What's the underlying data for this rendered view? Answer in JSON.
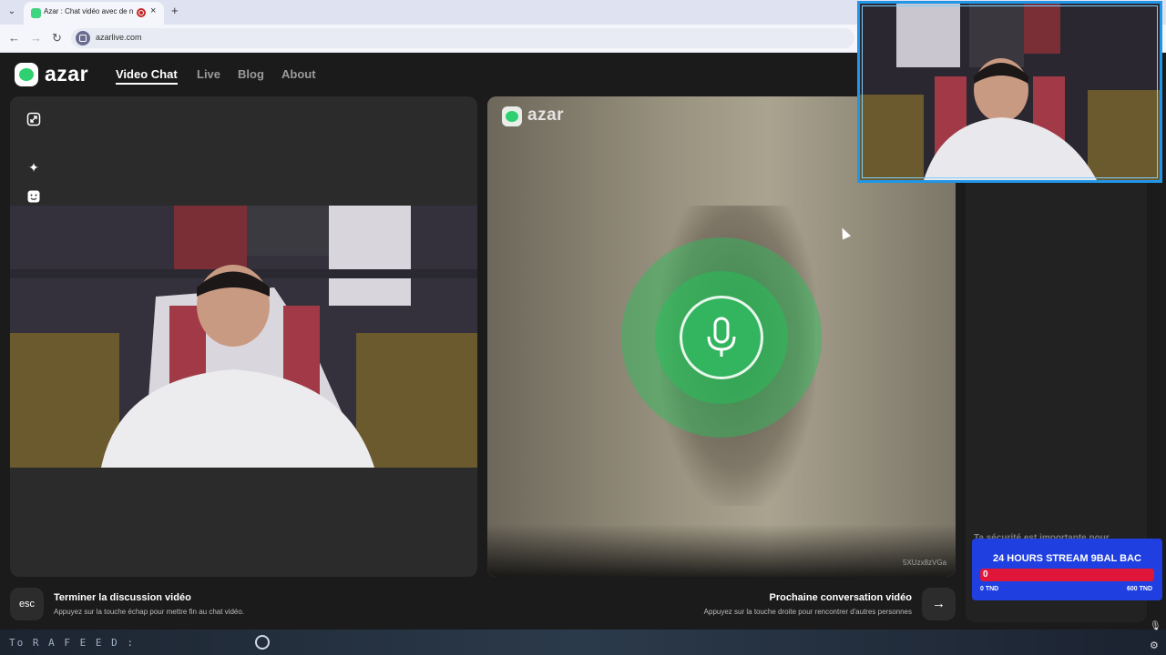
{
  "browser": {
    "tab_title": "Azar : Chat vidéo avec de n",
    "url": "azarlive.com",
    "new_tab_label": "+",
    "close_label": "×"
  },
  "site": {
    "logo_text": "azar",
    "nav": [
      {
        "label": "Video Chat",
        "active": true
      },
      {
        "label": "Live"
      },
      {
        "label": "Blog"
      },
      {
        "label": "About"
      }
    ]
  },
  "remote": {
    "logo_text": "azar",
    "id_text": "5XUzx8zVGa"
  },
  "side": {
    "text": "Ta sécurité est importante pour"
  },
  "controls": {
    "esc_label": "esc",
    "end_title": "Terminer la discussion vidéo",
    "end_subtitle": "Appuyez sur la touche échap pour mettre fin au chat vidéo.",
    "next_title": "Prochaine conversation vidéo",
    "next_subtitle": "Appuyez sur la touche droite pour rencontrer d'autres personnes"
  },
  "stream_goal": {
    "title": "24 HOURS STREAM 9BAL BAC",
    "current": "0",
    "min_label": "0 TND",
    "max_label": "600 TND",
    "progress": 0
  },
  "ticker": {
    "text": "To R A F E E D :"
  },
  "colors": {
    "brand_green": "#2fd06f",
    "goal_blue": "#1f3fe0",
    "goal_bar_red": "#e0153a",
    "overlay_border": "#2196e8"
  },
  "icons": {
    "expand": "expand-icon",
    "sparkle": "sparkle-icon",
    "face": "face-icon",
    "mic": "microphone-icon",
    "arrow": "arrow-right-icon"
  }
}
